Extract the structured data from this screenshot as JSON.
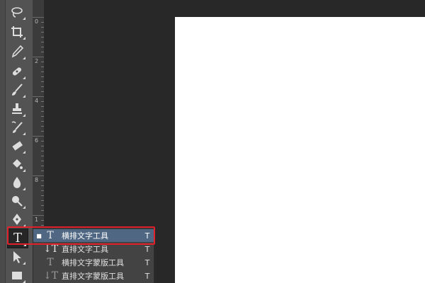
{
  "ruler": {
    "labels": [
      "0",
      "2",
      "4",
      "6",
      "8",
      "1"
    ]
  },
  "flyout": {
    "items": [
      {
        "icon": "horizontal-type-icon",
        "label": "横排文字工具",
        "shortcut": "T",
        "selected": true
      },
      {
        "icon": "vertical-type-icon",
        "label": "直排文字工具",
        "shortcut": "T",
        "selected": false
      },
      {
        "icon": "horizontal-type-mask-icon",
        "label": "横排文字蒙版工具",
        "shortcut": "T",
        "selected": false
      },
      {
        "icon": "vertical-type-mask-icon",
        "label": "直排文字蒙版工具",
        "shortcut": "T",
        "selected": false
      }
    ]
  },
  "colors": {
    "selected_bg": "#4f6783",
    "highlight_border": "#e0202a",
    "canvas": "#ffffff",
    "workspace": "#282828"
  }
}
